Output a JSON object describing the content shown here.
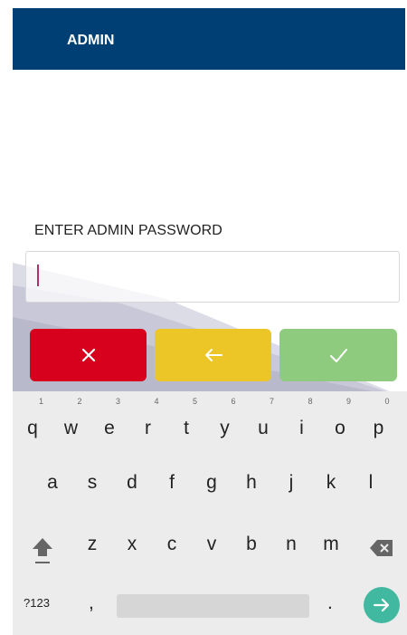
{
  "appbar": {
    "title": "ADMIN"
  },
  "form": {
    "label": "ENTER ADMIN PASSWORD",
    "value": ""
  },
  "buttons": [
    {
      "name": "cancel",
      "icon": "close-icon",
      "color": "#d7001d"
    },
    {
      "name": "back",
      "icon": "arrow-left-icon",
      "color": "#ecc626"
    },
    {
      "name": "confirm",
      "icon": "check-icon",
      "color": "#8fcb7f"
    }
  ],
  "keyboard": {
    "row1": [
      {
        "key": "q",
        "hint": "1"
      },
      {
        "key": "w",
        "hint": "2"
      },
      {
        "key": "e",
        "hint": "3"
      },
      {
        "key": "r",
        "hint": "4"
      },
      {
        "key": "t",
        "hint": "5"
      },
      {
        "key": "y",
        "hint": "6"
      },
      {
        "key": "u",
        "hint": "7"
      },
      {
        "key": "i",
        "hint": "8"
      },
      {
        "key": "o",
        "hint": "9"
      },
      {
        "key": "p",
        "hint": "0"
      }
    ],
    "row2": [
      "a",
      "s",
      "d",
      "f",
      "g",
      "h",
      "j",
      "k",
      "l"
    ],
    "row3": [
      "z",
      "x",
      "c",
      "v",
      "b",
      "n",
      "m"
    ],
    "symbols_label": "?123",
    "comma": ",",
    "period": ".",
    "enter_icon": "arrow-right-icon",
    "accent": "#41b8a0"
  }
}
